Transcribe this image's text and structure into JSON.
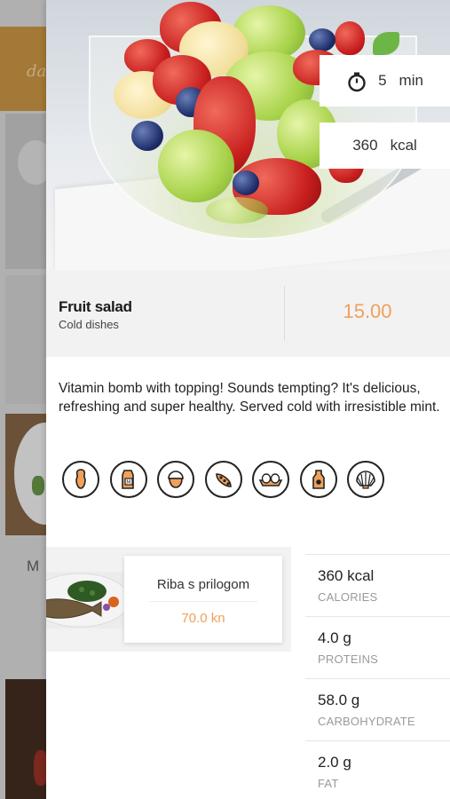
{
  "background_list": {
    "header_text": "da",
    "card_label": "M"
  },
  "dish": {
    "name": "Fruit salad",
    "category": "Cold dishes",
    "price": "15.00",
    "prep_time_value": "5",
    "prep_time_unit": "min",
    "calories_value": "360",
    "calories_unit": "kcal",
    "description": "Vitamin bomb with topping! Sounds tempting?  It's delicious, refreshing and super healthy. Served cold with irresistible mint."
  },
  "allergens": [
    {
      "icon": "peanut-icon"
    },
    {
      "icon": "milk-icon"
    },
    {
      "icon": "nut-icon"
    },
    {
      "icon": "soy-icon"
    },
    {
      "icon": "eggs-icon"
    },
    {
      "icon": "mustard-icon"
    },
    {
      "icon": "shellfish-icon"
    }
  ],
  "related_dish": {
    "name": "Riba s prilogom",
    "price": "70.0 kn"
  },
  "nutrition": [
    {
      "value": "360 kcal",
      "label": "CALORIES"
    },
    {
      "value": "4.0 g",
      "label": "PROTEINS"
    },
    {
      "value": "58.0 g",
      "label": "CARBOHYDRATE"
    },
    {
      "value": "2.0 g",
      "label": "FAT"
    }
  ],
  "colors": {
    "accent": "#f0a05a",
    "panel_bg": "#f2f2f2",
    "bg_header": "#c08a3a"
  }
}
